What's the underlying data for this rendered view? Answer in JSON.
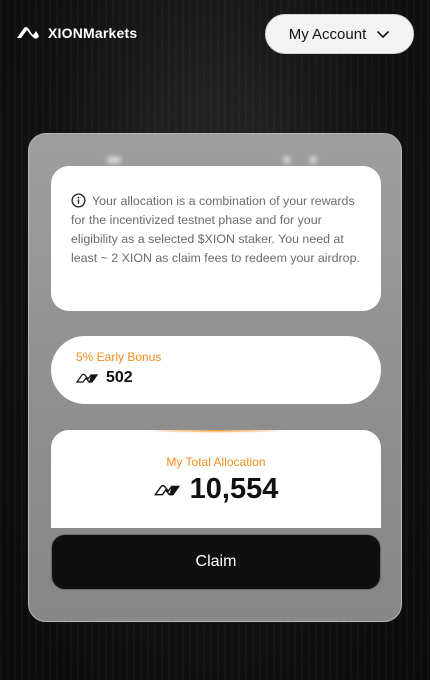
{
  "header": {
    "brand": "XIONMarkets",
    "account_label": "My Account",
    "icons": [
      "xion-logo-icon",
      "chevron-down-icon"
    ]
  },
  "info": {
    "icon": "info-icon",
    "text": "Your allocation is a combination of your rewards for the incentivized testnet phase and for your eligibility as a selected $XION staker. You need at least ~ 2 XION as claim fees to redeem your airdrop."
  },
  "bonus": {
    "label": "5% Early Bonus",
    "icon": "xion-token-icon",
    "value": "502"
  },
  "total": {
    "label": "My Total Allocation",
    "icon": "xion-token-icon",
    "value": "10,554"
  },
  "claim": {
    "label": "Claim"
  },
  "colors": {
    "accent": "#f28c1d",
    "button": "#0f0f0f",
    "panel": "#969696"
  }
}
